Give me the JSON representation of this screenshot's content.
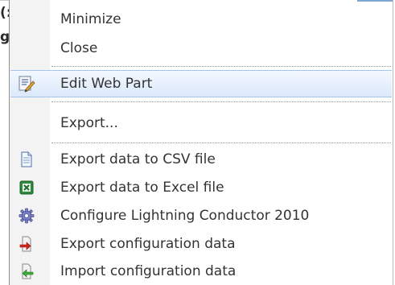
{
  "background": {
    "line1": "(:",
    "line2": "g"
  },
  "menu": {
    "items": [
      {
        "label": "Minimize",
        "icon": null
      },
      {
        "label": "Close",
        "icon": null
      },
      {
        "label": "Edit Web Part",
        "icon": "edit-web-part-icon"
      },
      {
        "label": "Export...",
        "icon": null
      },
      {
        "label": "Export data to CSV file",
        "icon": "csv-document-icon"
      },
      {
        "label": "Export data to Excel file",
        "icon": "excel-icon"
      },
      {
        "label": "Configure Lightning Conductor 2010",
        "icon": "gear-icon"
      },
      {
        "label": "Export configuration data",
        "icon": "export-arrow-icon"
      },
      {
        "label": "Import configuration data",
        "icon": "import-arrow-icon"
      }
    ]
  },
  "colors": {
    "highlight": "#dbe9fb",
    "highlight_border": "#a5c3ec",
    "text": "#333333"
  }
}
